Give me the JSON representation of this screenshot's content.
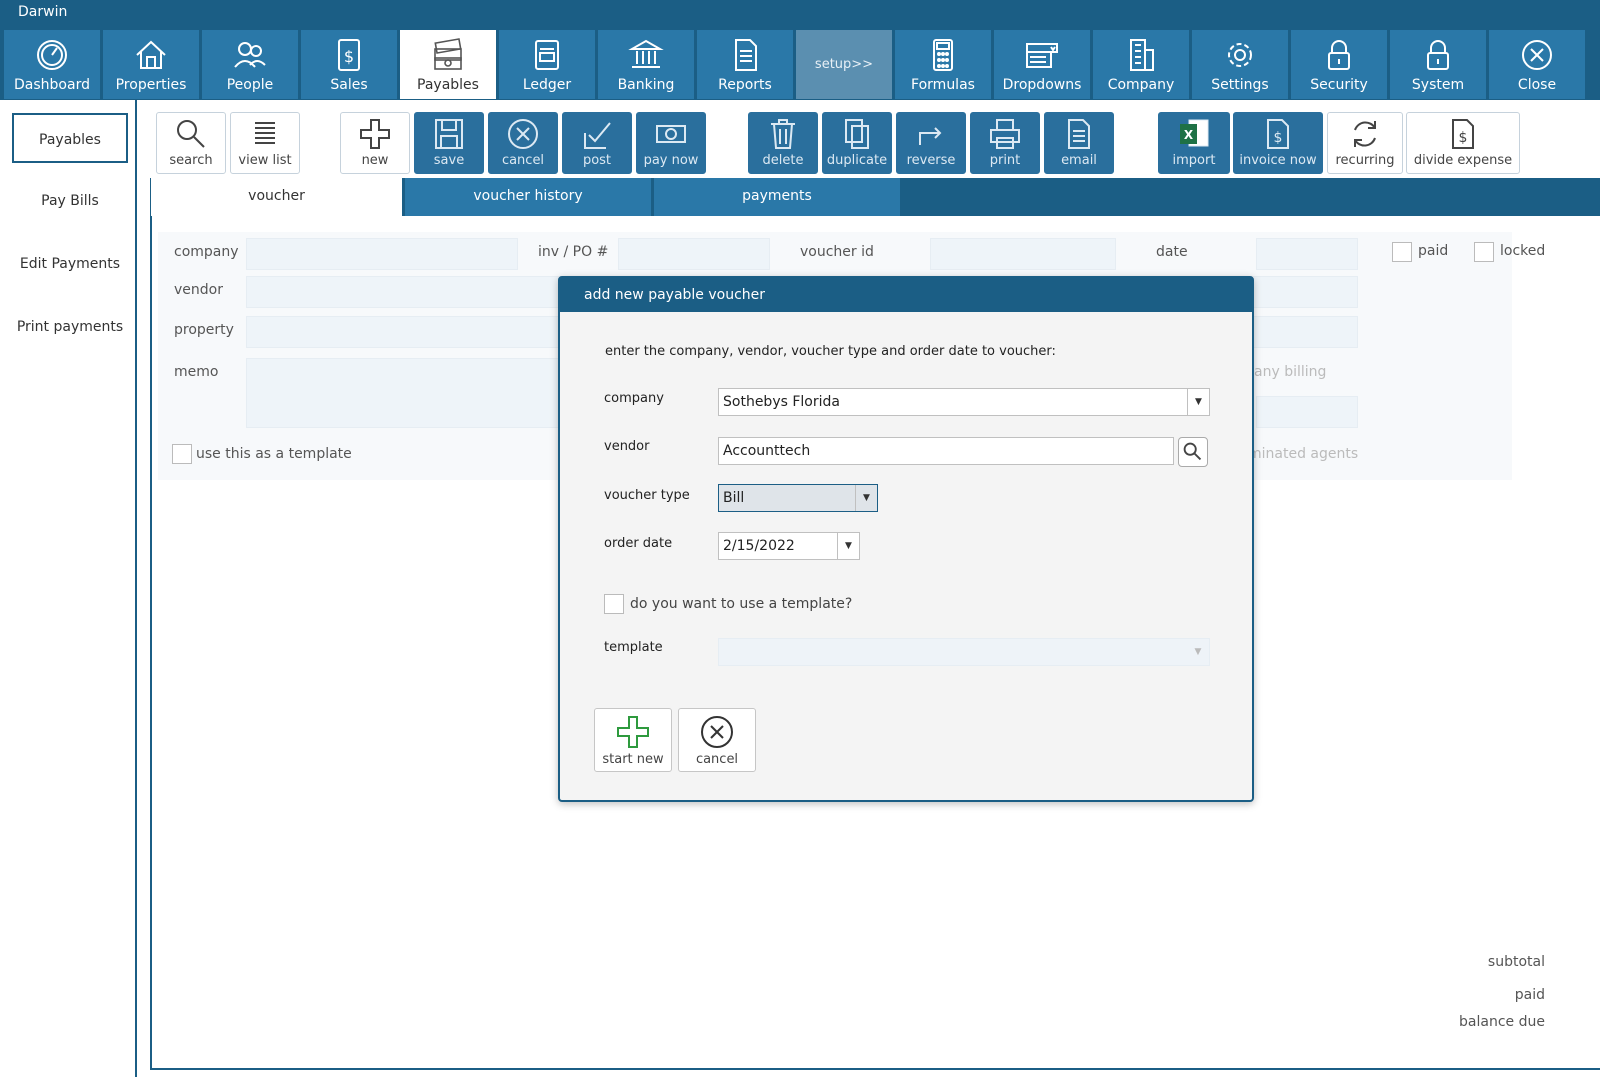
{
  "window": {
    "title": "Darwin"
  },
  "nav": {
    "items": [
      {
        "label": "Dashboard",
        "icon": "gauge-icon"
      },
      {
        "label": "Properties",
        "icon": "house-icon"
      },
      {
        "label": "People",
        "icon": "people-icon"
      },
      {
        "label": "Sales",
        "icon": "dollar-document-icon"
      },
      {
        "label": "Payables",
        "icon": "money-stack-icon"
      },
      {
        "label": "Ledger",
        "icon": "ledger-icon"
      },
      {
        "label": "Banking",
        "icon": "bank-icon"
      },
      {
        "label": "Reports",
        "icon": "report-icon"
      },
      {
        "label": "setup>>",
        "icon": ""
      },
      {
        "label": "Formulas",
        "icon": "calculator-icon"
      },
      {
        "label": "Dropdowns",
        "icon": "dropdown-icon"
      },
      {
        "label": "Company",
        "icon": "building-icon"
      },
      {
        "label": "Settings",
        "icon": "gear-icon"
      },
      {
        "label": "Security",
        "icon": "lock-icon"
      },
      {
        "label": "System",
        "icon": "lock-icon"
      },
      {
        "label": "Close",
        "icon": "close-icon"
      }
    ]
  },
  "sidebar": {
    "items": [
      {
        "label": "Payables"
      },
      {
        "label": "Pay Bills"
      },
      {
        "label": "Edit Payments"
      },
      {
        "label": "Print payments"
      }
    ]
  },
  "toolbar": {
    "search": "search",
    "view_list": "view list",
    "new": "new",
    "save": "save",
    "cancel": "cancel",
    "post": "post",
    "pay_now": "pay now",
    "delete": "delete",
    "duplicate": "duplicate",
    "reverse": "reverse",
    "print": "print",
    "email": "email",
    "import": "import",
    "invoice_now": "invoice now",
    "recurring": "recurring",
    "divide_expense": "divide expense"
  },
  "tabs": {
    "voucher": "voucher",
    "voucher_history": "voucher history",
    "payments": "payments"
  },
  "form": {
    "company_label": "company",
    "inv_po_label": "inv / PO #",
    "voucher_id_label": "voucher id",
    "date_label": "date",
    "paid_label": "paid",
    "locked_label": "locked",
    "vendor_label": "vendor",
    "property_label": "property",
    "memo_label": "memo",
    "template_label": "use this as a template",
    "partial_billing": "any billing",
    "partial_agents": "minated agents"
  },
  "totals": {
    "subtotal": "subtotal",
    "paid": "paid",
    "balance_due": "balance due"
  },
  "dialog": {
    "title": "add new payable voucher",
    "instruction": "enter the company, vendor, voucher type and order date to voucher:",
    "company_label": "company",
    "company_value": "Sothebys Florida",
    "vendor_label": "vendor",
    "vendor_value": "Accounttech",
    "voucher_type_label": "voucher type",
    "voucher_type_value": "Bill",
    "order_date_label": "order date",
    "order_date_value": "2/15/2022",
    "use_template_label": "do you want to use a template?",
    "template_label": "template",
    "template_value": "",
    "start_new": "start new",
    "cancel": "cancel"
  },
  "colors": {
    "brand": "#1b5e85",
    "nav_button": "#2a78a8",
    "field_bg": "#eef4f9"
  }
}
